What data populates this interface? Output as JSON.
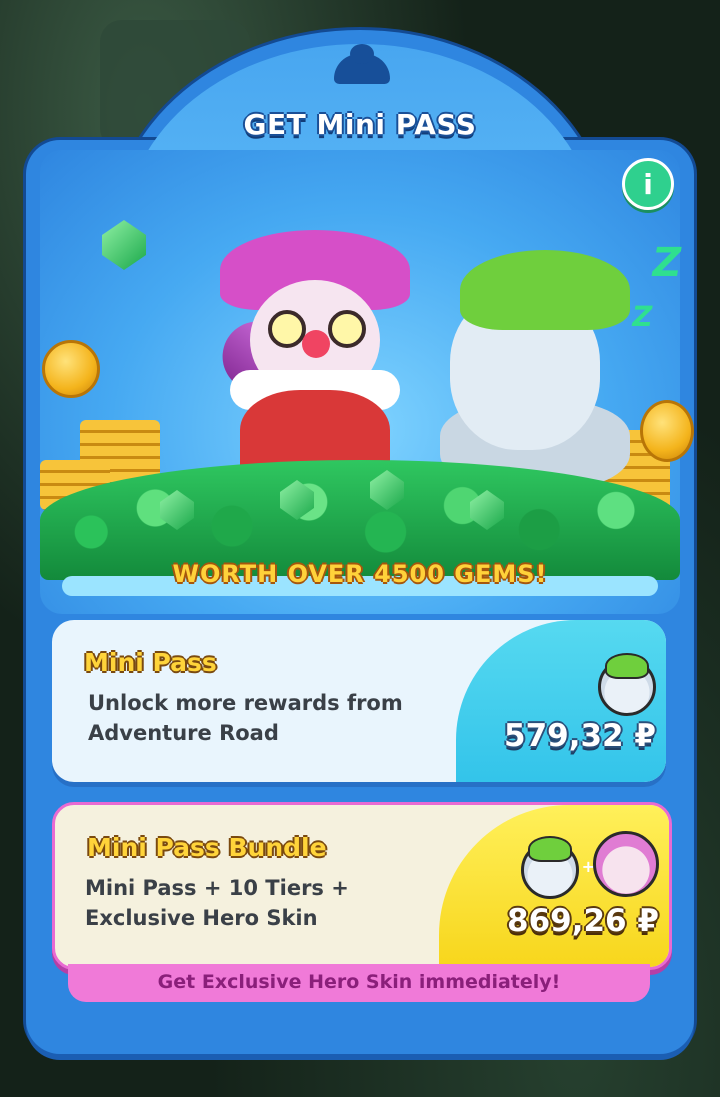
{
  "header": {
    "title": "GET Mini PASS",
    "info_label": "i"
  },
  "banner": {
    "worth_text": "WORTH OVER 4500 GEMS!",
    "zz": "Z"
  },
  "offers": [
    {
      "title": "Mini Pass",
      "description": "Unlock more rewards from Adventure Road",
      "price": "579,32 ₽",
      "icons": [
        "yeti-hero-icon"
      ]
    },
    {
      "title": "Mini Pass Bundle",
      "description": "Mini Pass + 10 Tiers + Exclusive Hero Skin",
      "price": "869,26 ₽",
      "icons": [
        "yeti-hero-icon",
        "jester-hero-icon"
      ],
      "plus": "+",
      "ribbon": "Get Exclusive Hero Skin immediately!"
    }
  ],
  "colors": {
    "panel": "#2f86e0",
    "gem": "#2fc760",
    "price_bundle_bg": "#f7d61c",
    "ribbon": "#f07ad8"
  }
}
